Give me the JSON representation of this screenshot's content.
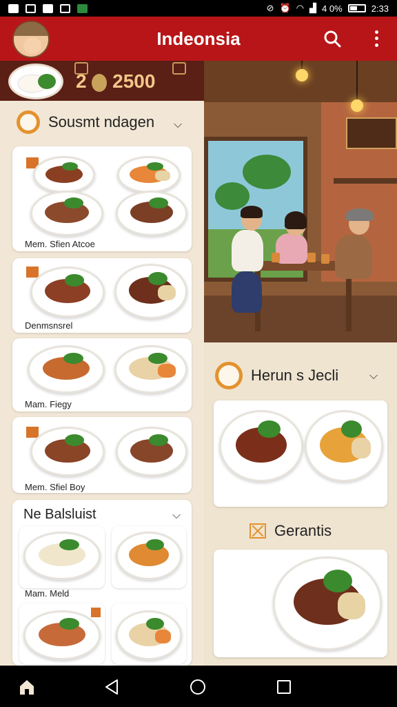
{
  "status_bar": {
    "battery_text": "4 0%",
    "time": "2:33"
  },
  "app_bar": {
    "title": "Indeonsia"
  },
  "banner": {
    "points": "2500",
    "points_prefix": "2"
  },
  "left": {
    "section1": {
      "title": "Sousmt ndagen",
      "cards": [
        {
          "label": "Mem. Sfien Atcoe"
        },
        {
          "label": "Denmsnsrel"
        },
        {
          "label": "Mam. Fiegy"
        },
        {
          "label": "Mem. Sfiel Boy"
        }
      ]
    },
    "section2": {
      "title": "Ne Balsluist",
      "cards": [
        {
          "label": "Mam. Meld"
        }
      ]
    }
  },
  "right": {
    "section1": {
      "title": "Herun s Jecli"
    },
    "section2": {
      "title": "Gerantis"
    }
  },
  "colors": {
    "app_bar": "#b81518",
    "accent": "#e3922e",
    "background": "#efe4d0"
  },
  "icons": {
    "nav": [
      "home-icon",
      "back-icon",
      "home-circle-icon",
      "recents-icon"
    ],
    "app_bar": [
      "avatar",
      "search-icon",
      "more-vert-icon"
    ]
  }
}
